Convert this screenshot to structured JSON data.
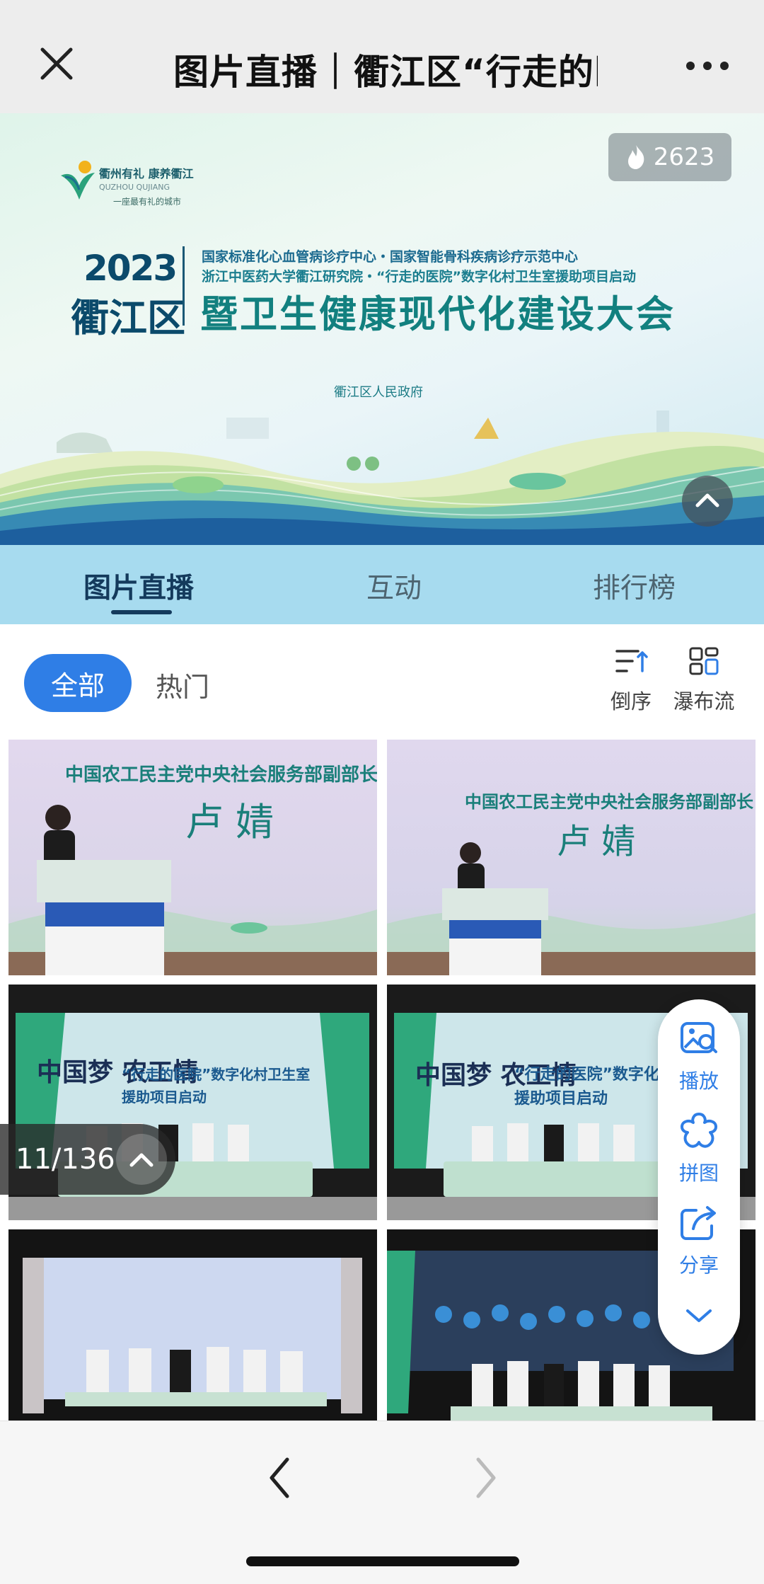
{
  "topbar": {
    "title": "图片直播｜衢江区“行走的医"
  },
  "banner": {
    "heat_count": "2623",
    "logo_text": "衢州有礼 康养衢江",
    "logo_sub": "QUZHOU  QUJIANG",
    "logo_slogan": "一座最有礼的城市",
    "year": "2023",
    "district": "衢江区",
    "line1": "国家标准化心血管病诊疗中心・国家智能骨科疾病诊疗示范中心",
    "line2": "浙江中医药大学衢江研究院・“行走的医院”数字化村卫生室援助项目启动",
    "headline": "暨卫生健康现代化建设大会",
    "organizer": "衢江区人民政府"
  },
  "tabs": [
    {
      "label": "图片直播",
      "active": true
    },
    {
      "label": "互动",
      "active": false
    },
    {
      "label": "排行榜",
      "active": false
    }
  ],
  "filter": {
    "all_label": "全部",
    "hot_label": "热门",
    "reverse_label": "倒序",
    "waterfall_label": "瀑布流"
  },
  "photos": [
    {
      "caption_top": "中国农工民主党中央社会服务部副部长",
      "caption_name": "卢 婧",
      "kind": "speech"
    },
    {
      "caption_top": "中国农工民主党中央社会服务部副部长",
      "caption_name": "卢 婧",
      "kind": "speech"
    },
    {
      "caption_brush": "中国梦 农工情",
      "caption_title": "“行走的医院”数字化村卫生室",
      "caption_sub": "援助项目启动",
      "kind": "group"
    },
    {
      "caption_brush": "中国梦 农工情",
      "caption_title": "“行走的医院”数字化",
      "caption_sub": "援助项目启动",
      "kind": "group"
    },
    {
      "kind": "group-blank"
    },
    {
      "kind": "video-wall"
    }
  ],
  "counter": {
    "text": "11/136"
  },
  "tools": [
    {
      "label": "播放",
      "icon": "image-search-icon"
    },
    {
      "label": "拼图",
      "icon": "puzzle-icon"
    },
    {
      "label": "分享",
      "icon": "share-icon"
    },
    {
      "label": "",
      "icon": "chevron-down-icon"
    }
  ],
  "colors": {
    "accent": "#2f7ee6",
    "tab_bg": "#a7dbef",
    "tab_active": "#143a5c",
    "topbar_bg": "#ededed"
  }
}
